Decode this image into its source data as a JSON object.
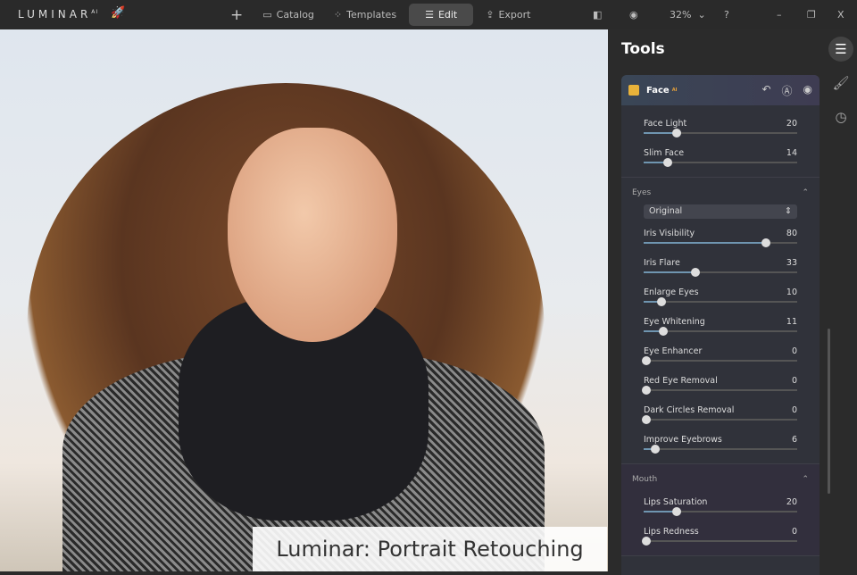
{
  "app": {
    "logo": "LUMINAR",
    "logo_sup": "AI"
  },
  "nav": {
    "add": "+",
    "catalog": "Catalog",
    "templates": "Templates",
    "edit": "Edit",
    "export": "Export"
  },
  "controls": {
    "zoom": "32%",
    "compare": "◧",
    "eye": "◉",
    "help": "?",
    "minimize": "–",
    "restore": "❐",
    "close": "X"
  },
  "caption": "Luminar: Portrait Retouching",
  "panel": {
    "title": "Tools",
    "tool": {
      "name": "Face",
      "badge": "AI"
    },
    "face_sliders": [
      {
        "label": "Face Light",
        "value": 20
      },
      {
        "label": "Slim Face",
        "value": 14
      }
    ],
    "eyes": {
      "title": "Eyes",
      "select": "Original",
      "sliders": [
        {
          "label": "Iris Visibility",
          "value": 80
        },
        {
          "label": "Iris Flare",
          "value": 33
        },
        {
          "label": "Enlarge Eyes",
          "value": 10
        },
        {
          "label": "Eye Whitening",
          "value": 11
        },
        {
          "label": "Eye Enhancer",
          "value": 0
        },
        {
          "label": "Red Eye Removal",
          "value": 0
        },
        {
          "label": "Dark Circles Removal",
          "value": 0
        },
        {
          "label": "Improve Eyebrows",
          "value": 6
        }
      ]
    },
    "mouth": {
      "title": "Mouth",
      "sliders": [
        {
          "label": "Lips Saturation",
          "value": 20
        },
        {
          "label": "Lips Redness",
          "value": 0
        }
      ]
    }
  },
  "colors": {
    "accent": "#6f95b0",
    "face_icon": "#e8b23a"
  }
}
